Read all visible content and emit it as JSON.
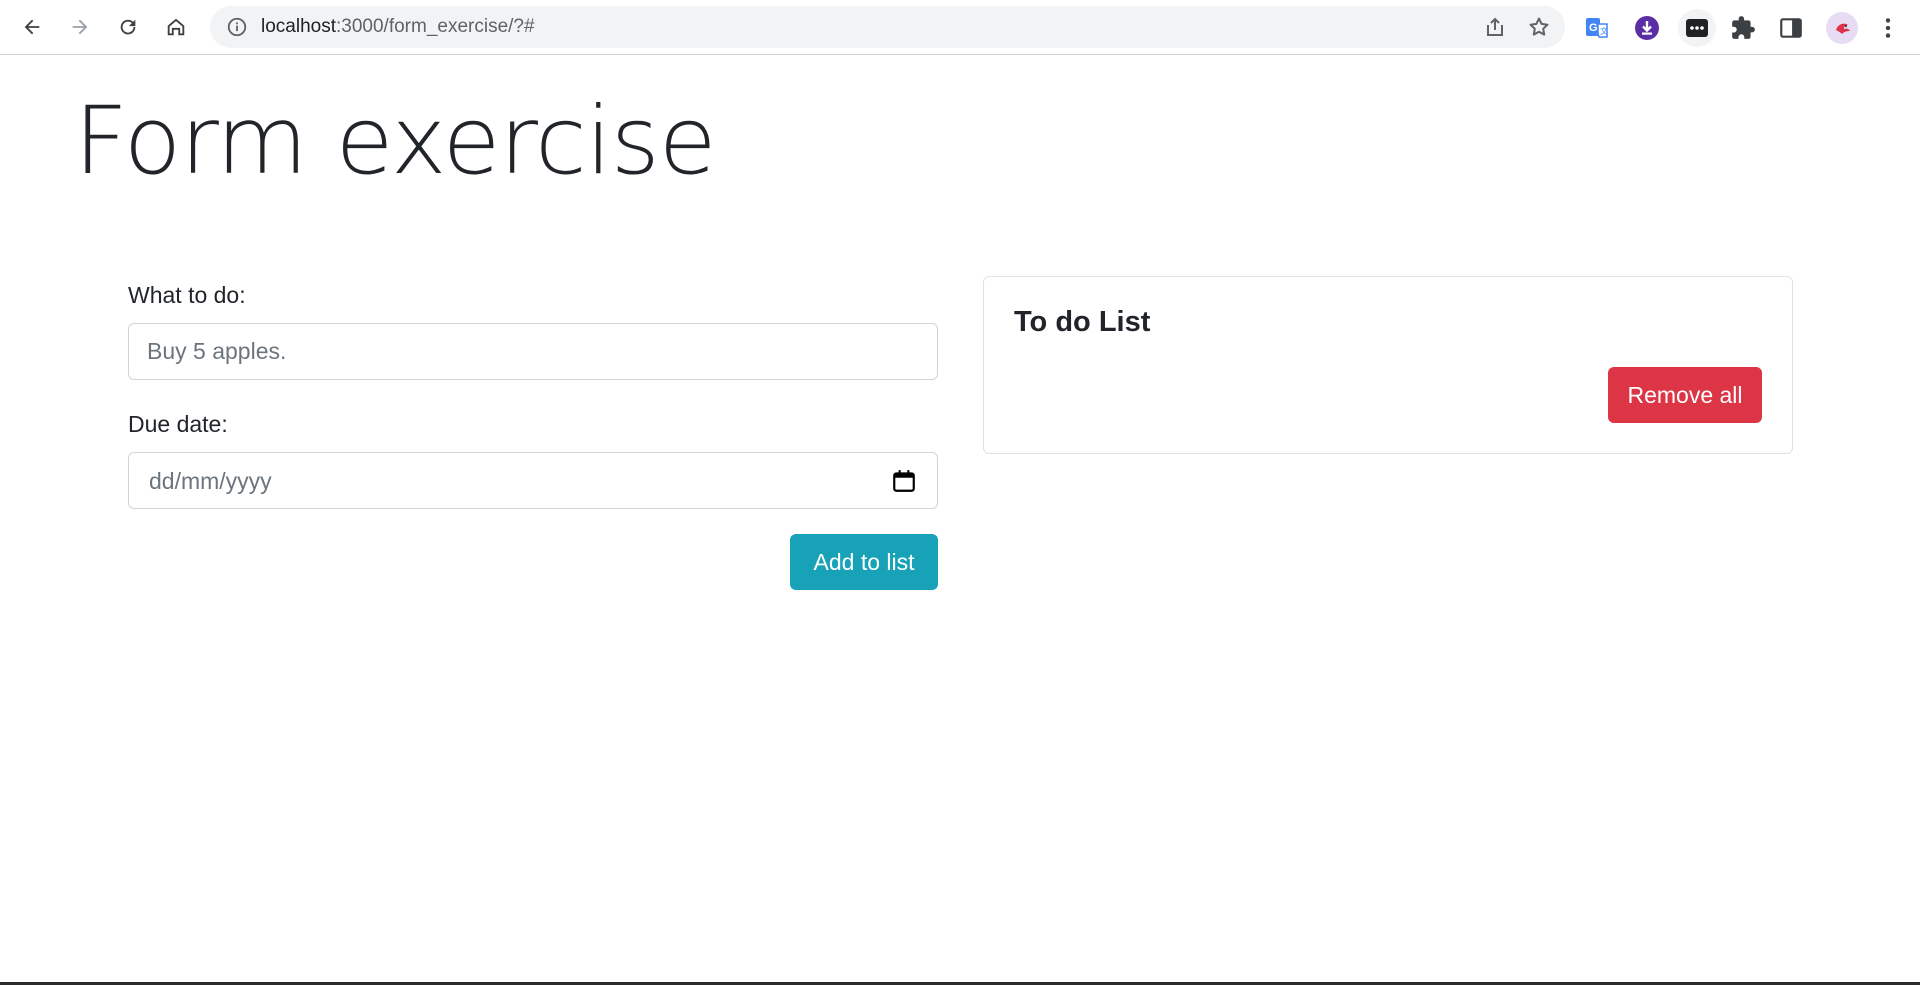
{
  "browser": {
    "url_host": "localhost",
    "url_path": ":3000/form_exercise/?#",
    "nav_icons": [
      "back-arrow-icon",
      "forward-arrow-icon",
      "reload-icon",
      "home-icon"
    ],
    "omnibox_icons": [
      "site-info-icon",
      "share-icon",
      "bookmark-star-icon"
    ],
    "extension_icons": [
      "translate-icon",
      "download-icon",
      "extension-active-icon",
      "puzzle-icon",
      "side-panel-icon",
      "profile-avatar-icon",
      "menu-dots-icon"
    ]
  },
  "page": {
    "title": "Form exercise",
    "form": {
      "todo_label": "What to do:",
      "todo_placeholder": "Buy 5 apples.",
      "todo_value": "",
      "date_label": "Due date:",
      "date_placeholder": "dd/mm/yyyy",
      "add_button": "Add to list"
    },
    "list": {
      "title": "To do List",
      "items": [],
      "remove_button": "Remove all"
    }
  },
  "colors": {
    "primary_info": "#17a2b8",
    "danger": "#dc3545",
    "text": "#212529",
    "muted": "#6c757d",
    "border": "#ced4da"
  }
}
